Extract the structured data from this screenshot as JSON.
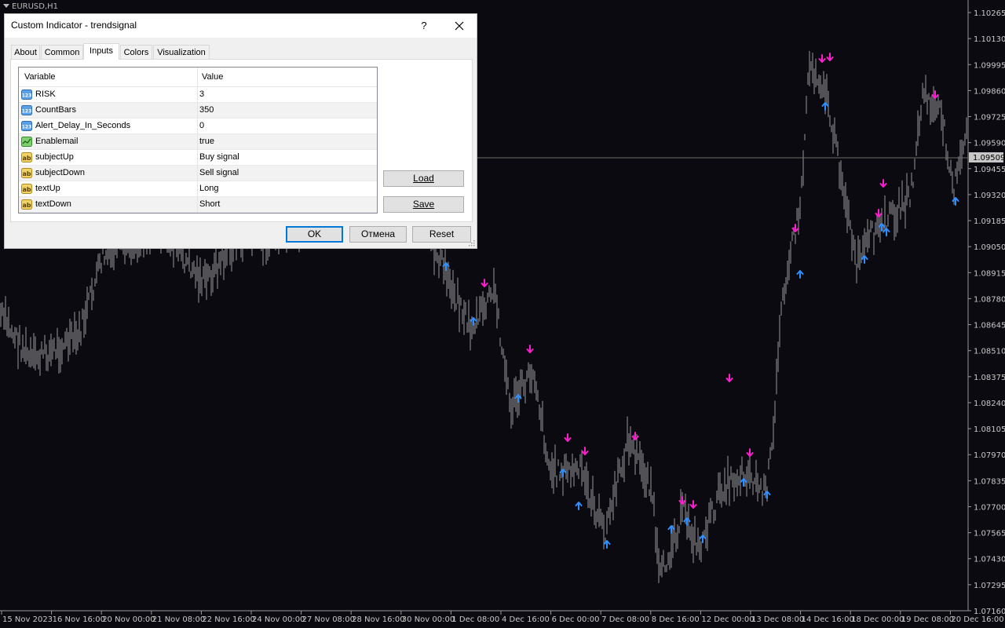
{
  "chart": {
    "symbol_title": "EURUSD,H1",
    "price_labels": [
      "1.10265",
      "1.10130",
      "1.09995",
      "1.09860",
      "1.09725",
      "1.09590",
      "1.09455",
      "1.09320",
      "1.09185",
      "1.09050",
      "1.08915",
      "1.08780",
      "1.08645",
      "1.08510",
      "1.08375",
      "1.08240",
      "1.08105",
      "1.07970",
      "1.07835",
      "1.07700",
      "1.07565",
      "1.07430",
      "1.07295",
      "1.07160"
    ],
    "current_price": "1.09509",
    "time_labels": [
      "15 Nov 2023",
      "16 Nov 16:00",
      "20 Nov 00:00",
      "21 Nov 08:00",
      "22 Nov 16:00",
      "24 Nov 00:00",
      "27 Nov 08:00",
      "28 Nov 16:00",
      "30 Nov 00:00",
      "1 Dec 08:00",
      "4 Dec 16:00",
      "6 Dec 00:00",
      "7 Dec 08:00",
      "8 Dec 16:00",
      "12 Dec 00:00",
      "13 Dec 08:00",
      "14 Dec 16:00",
      "18 Dec 00:00",
      "19 Dec 08:00",
      "20 Dec 16:00"
    ],
    "colors": {
      "background": "#0b0a10",
      "bars": "#b4b4b4",
      "buy_arrow": "#2f8fff",
      "sell_arrow": "#ff1ecf",
      "axis_text": "#c8c8c8"
    }
  },
  "dialog": {
    "title": "Custom Indicator - trendsignal",
    "help_label": "?",
    "tabs": [
      {
        "label": "About"
      },
      {
        "label": "Common"
      },
      {
        "label": "Inputs"
      },
      {
        "label": "Colors"
      },
      {
        "label": "Visualization"
      }
    ],
    "active_tab": "Inputs",
    "grid_headers": {
      "variable": "Variable",
      "value": "Value"
    },
    "inputs": [
      {
        "icon": "number-icon",
        "name": "RISK",
        "value": "3"
      },
      {
        "icon": "number-icon",
        "name": "CountBars",
        "value": "350"
      },
      {
        "icon": "number-icon",
        "name": "Alert_Delay_In_Seconds",
        "value": "0"
      },
      {
        "icon": "boolean-icon",
        "name": "Enablemail",
        "value": "true"
      },
      {
        "icon": "string-icon",
        "name": "subjectUp",
        "value": "Buy signal"
      },
      {
        "icon": "string-icon",
        "name": "subjectDown",
        "value": "Sell signal"
      },
      {
        "icon": "string-icon",
        "name": "textUp",
        "value": "Long"
      },
      {
        "icon": "string-icon",
        "name": "textDown",
        "value": "Short"
      }
    ],
    "buttons": {
      "load": "Load",
      "save": "Save",
      "ok": "OK",
      "cancel": "Отмена",
      "reset": "Reset"
    }
  }
}
